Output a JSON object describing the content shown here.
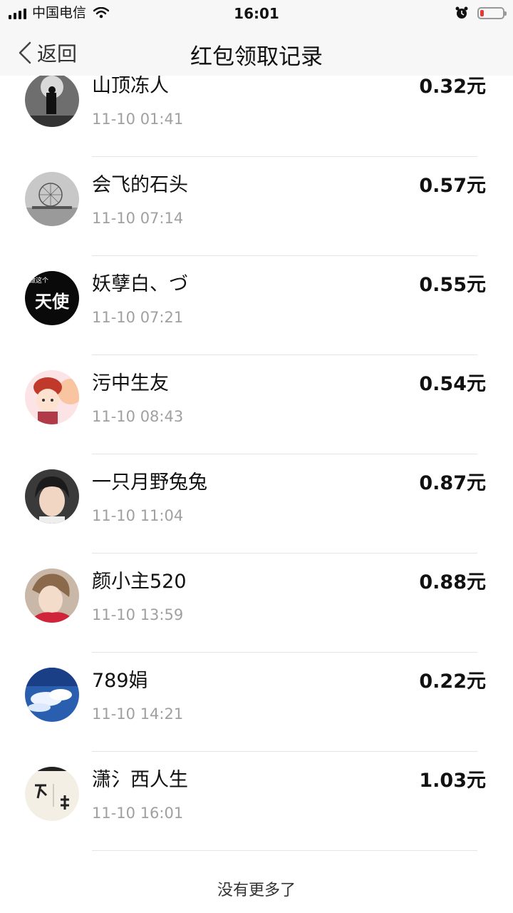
{
  "status_bar": {
    "carrier": "中国电信",
    "time": "16:01",
    "battery_level": 0.15
  },
  "header": {
    "back_label": "返回",
    "title": "红包领取记录"
  },
  "records": [
    {
      "name": "山顶冻人",
      "time": "11-10 01:41",
      "amount": "0.32元",
      "avatar": "silhouette-avatar"
    },
    {
      "name": "会飞的石头",
      "time": "11-10 07:14",
      "amount": "0.57元",
      "avatar": "ferris-wheel-avatar"
    },
    {
      "name": "妖孽白、づ",
      "time": "11-10 07:21",
      "amount": "0.55元",
      "avatar": "text-avatar",
      "avatar_small_text": "做这个",
      "avatar_text": "天使"
    },
    {
      "name": "污中生友",
      "time": "11-10 08:43",
      "amount": "0.54元",
      "avatar": "cartoon-avatar"
    },
    {
      "name": "一只月野兔兔",
      "time": "11-10 11:04",
      "amount": "0.87元",
      "avatar": "portrait-avatar"
    },
    {
      "name": "颜小主520",
      "time": "11-10 13:59",
      "amount": "0.88元",
      "avatar": "portrait-avatar"
    },
    {
      "name": "789娟",
      "time": "11-10 14:21",
      "amount": "0.22元",
      "avatar": "sky-avatar"
    },
    {
      "name": "潇氵西人生",
      "time": "11-10 16:01",
      "amount": "1.03元",
      "avatar": "calligraphy-avatar"
    }
  ],
  "footer": {
    "text": "没有更多了"
  }
}
